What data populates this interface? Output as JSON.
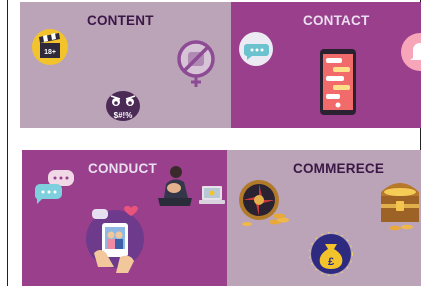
{
  "panels": {
    "content": {
      "label": "CONTENT",
      "color": "#bba4b7"
    },
    "contact": {
      "label": "CONTACT",
      "color": "#9a3f8c"
    },
    "conduct": {
      "label": "CONDUCT",
      "color": "#9a3f8c"
    },
    "commerce": {
      "label": "COMMERECE",
      "color": "#bba4b7"
    }
  },
  "badges": {
    "age_rating": "18+",
    "profanity": "$#!%",
    "money": "£"
  },
  "icons": [
    "clapperboard-icon",
    "no-fist-icon",
    "angry-face-icon",
    "chat-bubble-icon",
    "smartphone-chat-icon",
    "notification-bell-icon",
    "chat-bubbles-icon",
    "sad-person-icon",
    "laptop-icon",
    "phone-photo-like-icon",
    "roulette-wheel-icon",
    "treasure-chest-icon",
    "money-bag-icon"
  ]
}
